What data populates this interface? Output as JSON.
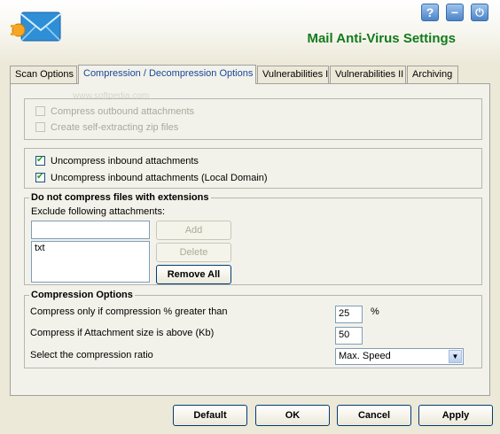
{
  "window": {
    "app_title": "Mail Anti-Virus Settings",
    "help_glyph": "?",
    "minimize_glyph": "−",
    "power_glyph": "⏻",
    "watermark": "www.softpedia.com"
  },
  "tabs": [
    {
      "label": "Scan Options",
      "active": false
    },
    {
      "label": "Compression / Decompression Options",
      "active": true
    },
    {
      "label": "Vulnerabilities I",
      "active": false
    },
    {
      "label": "Vulnerabilities II",
      "active": false
    },
    {
      "label": "Archiving",
      "active": false
    }
  ],
  "compress": {
    "outbound_label": "Compress outbound attachments",
    "outbound_checked": false,
    "selfextract_label": "Create self-extracting zip files",
    "selfextract_checked": false
  },
  "uncompress": {
    "inbound_label": "Uncompress inbound attachments",
    "inbound_checked": true,
    "local_label": "Uncompress inbound attachments (Local Domain)",
    "local_checked": true
  },
  "exclude": {
    "group_title": "Do not compress files with extensions",
    "subtitle": "Exclude following attachments:",
    "input_value": "",
    "list_items": [
      "txt"
    ],
    "add_label": "Add",
    "delete_label": "Delete",
    "remove_all_label": "Remove All"
  },
  "compression_options": {
    "group_title": "Compression Options",
    "percent_label": "Compress only if compression % greater than",
    "percent_value": "25",
    "percent_unit": "%",
    "size_label": "Compress if Attachment size is above (Kb)",
    "size_value": "50",
    "ratio_label": "Select the compression ratio",
    "ratio_value": "Max. Speed"
  },
  "footer": {
    "default_label": "Default",
    "ok_label": "OK",
    "cancel_label": "Cancel",
    "apply_label": "Apply"
  },
  "colors": {
    "title_green": "#127b1c",
    "active_tab_text": "#15479a",
    "check_green": "#21a121"
  }
}
